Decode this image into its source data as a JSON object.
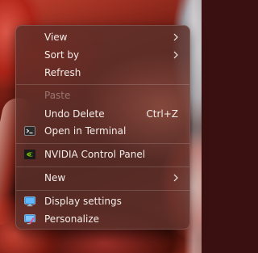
{
  "context_menu": {
    "items": [
      {
        "label": "View"
      },
      {
        "label": "Sort by"
      },
      {
        "label": "Refresh"
      },
      {
        "label": "Paste"
      },
      {
        "label": "Undo Delete",
        "shortcut": "Ctrl+Z"
      },
      {
        "label": "Open in Terminal"
      },
      {
        "label": "NVIDIA Control Panel"
      },
      {
        "label": "New"
      },
      {
        "label": "Display settings"
      },
      {
        "label": "Personalize"
      }
    ]
  },
  "colors": {
    "menu_background": "#5c302a",
    "text": "#f4ece8",
    "nvidia_green": "#76b900",
    "display_blue": "#3a9be8"
  }
}
